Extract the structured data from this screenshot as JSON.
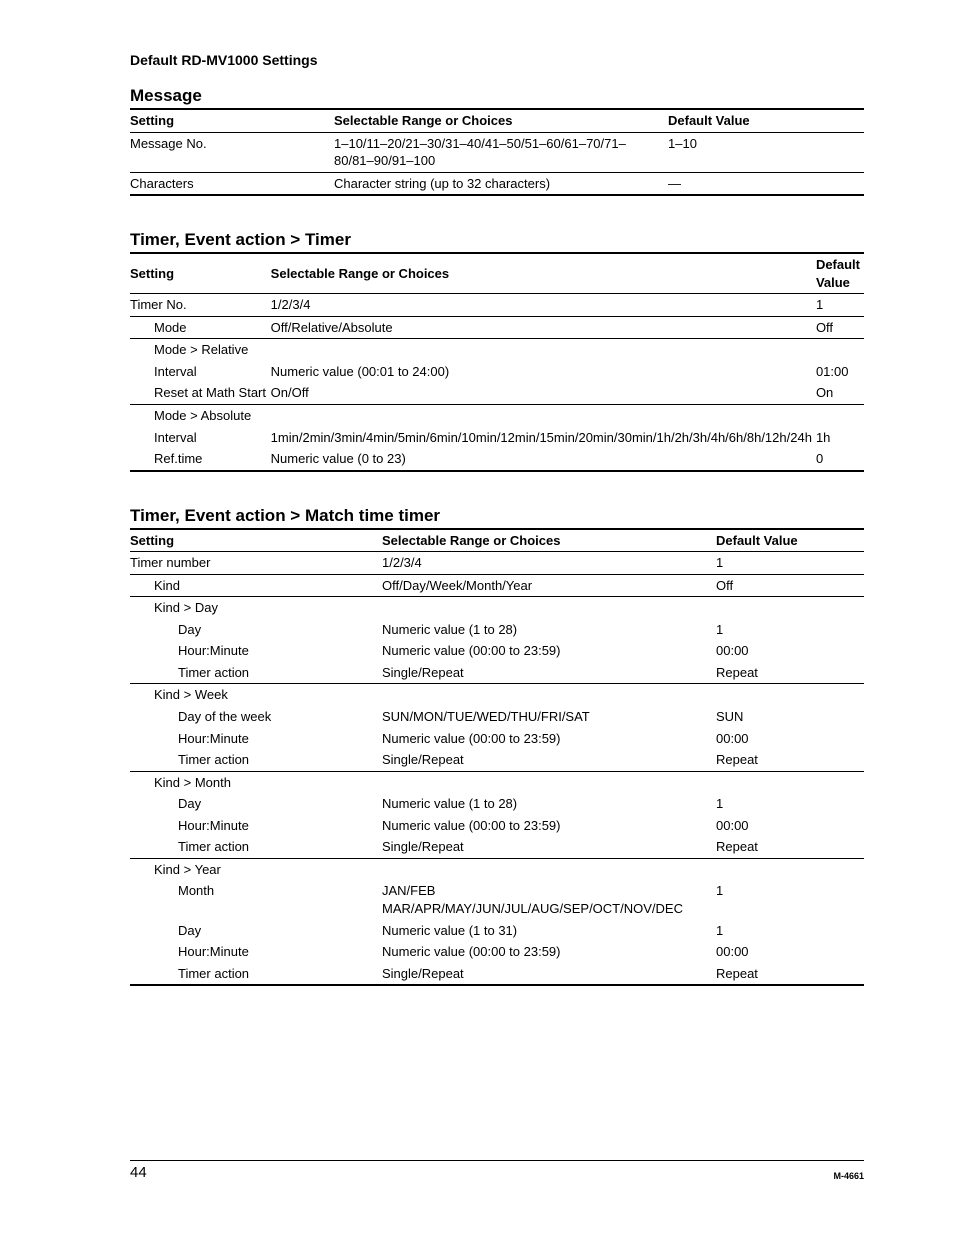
{
  "pageHeader": "Default RD-MV1000 Settings",
  "columns": {
    "setting": "Setting",
    "choices": "Selectable Range or Choices",
    "default": "Default Value"
  },
  "sections": [
    {
      "title": "Message",
      "rows": [
        {
          "indent": 0,
          "setting": "Message No.",
          "choices": "1–10/11–20/21–30/31–40/41–50/51–60/61–70/71–80/81–90/91–100",
          "default": "1–10",
          "border": "thin"
        },
        {
          "indent": 0,
          "setting": "Characters",
          "choices": "Character string (up to 32 characters)",
          "default": "—",
          "border": "thick"
        }
      ]
    },
    {
      "title": "Timer, Event action > Timer",
      "rows": [
        {
          "indent": 0,
          "setting": "Timer No.",
          "choices": "1/2/3/4",
          "default": "1",
          "border": "thin"
        },
        {
          "indent": 1,
          "setting": "Mode",
          "choices": "Off/Relative/Absolute",
          "default": "Off",
          "border": "thin"
        },
        {
          "indent": 1,
          "setting": "Mode > Relative",
          "choices": "",
          "default": "",
          "border": "none"
        },
        {
          "indent": 1,
          "setting": "Interval",
          "choices": "Numeric value (00:01 to 24:00)",
          "default": "01:00",
          "border": "none"
        },
        {
          "indent": 1,
          "setting": "Reset at Math Start",
          "choices": "On/Off",
          "default": "On",
          "border": "thin"
        },
        {
          "indent": 1,
          "setting": "Mode > Absolute",
          "choices": "",
          "default": "",
          "border": "none"
        },
        {
          "indent": 1,
          "setting": "Interval",
          "choices": "1min/2min/3min/4min/5min/6min/10min/12min/15min/20min/30min/1h/2h/3h/4h/6h/8h/12h/24h",
          "default": "1h",
          "border": "none"
        },
        {
          "indent": 1,
          "setting": "Ref.time",
          "choices": "Numeric value (0 to 23)",
          "default": "0",
          "border": "thick"
        }
      ]
    },
    {
      "title": "Timer, Event action > Match time timer",
      "rows": [
        {
          "indent": 0,
          "setting": "Timer number",
          "choices": "1/2/3/4",
          "default": "1",
          "border": "thin"
        },
        {
          "indent": 1,
          "setting": "Kind",
          "choices": "Off/Day/Week/Month/Year",
          "default": "Off",
          "border": "thin"
        },
        {
          "indent": 1,
          "setting": "Kind > Day",
          "choices": "",
          "default": "",
          "border": "none"
        },
        {
          "indent": 2,
          "setting": "Day",
          "choices": "Numeric value (1 to 28)",
          "default": "1",
          "border": "none"
        },
        {
          "indent": 2,
          "setting": "Hour:Minute",
          "choices": "Numeric value (00:00 to 23:59)",
          "default": "00:00",
          "border": "none"
        },
        {
          "indent": 2,
          "setting": "Timer action",
          "choices": "Single/Repeat",
          "default": "Repeat",
          "border": "thin"
        },
        {
          "indent": 1,
          "setting": "Kind > Week",
          "choices": "",
          "default": "",
          "border": "none"
        },
        {
          "indent": 2,
          "setting": "Day of the week",
          "choices": "SUN/MON/TUE/WED/THU/FRI/SAT",
          "default": "SUN",
          "border": "none"
        },
        {
          "indent": 2,
          "setting": "Hour:Minute",
          "choices": "Numeric value (00:00 to 23:59)",
          "default": "00:00",
          "border": "none"
        },
        {
          "indent": 2,
          "setting": "Timer action",
          "choices": "Single/Repeat",
          "default": "Repeat",
          "border": "thin"
        },
        {
          "indent": 1,
          "setting": "Kind > Month",
          "choices": "",
          "default": "",
          "border": "none"
        },
        {
          "indent": 2,
          "setting": "Day",
          "choices": "Numeric value (1 to 28)",
          "default": "1",
          "border": "none"
        },
        {
          "indent": 2,
          "setting": "Hour:Minute",
          "choices": "Numeric value (00:00 to 23:59)",
          "default": "00:00",
          "border": "none"
        },
        {
          "indent": 2,
          "setting": "Timer action",
          "choices": "Single/Repeat",
          "default": "Repeat",
          "border": "thin"
        },
        {
          "indent": 1,
          "setting": "Kind > Year",
          "choices": "",
          "default": "",
          "border": "none"
        },
        {
          "indent": 2,
          "setting": "Month",
          "choices": "JAN/FEB MAR/APR/MAY/JUN/JUL/AUG/SEP/OCT/NOV/DEC",
          "default": "1",
          "border": "none"
        },
        {
          "indent": 2,
          "setting": "Day",
          "choices": "Numeric value (1 to 31)",
          "default": "1",
          "border": "none"
        },
        {
          "indent": 2,
          "setting": "Hour:Minute",
          "choices": "Numeric value (00:00 to 23:59)",
          "default": "00:00",
          "border": "none"
        },
        {
          "indent": 2,
          "setting": "Timer action",
          "choices": "Single/Repeat",
          "default": "Repeat",
          "border": "thick"
        }
      ]
    }
  ],
  "footer": {
    "pageNumber": "44",
    "docId": "M-4661"
  }
}
